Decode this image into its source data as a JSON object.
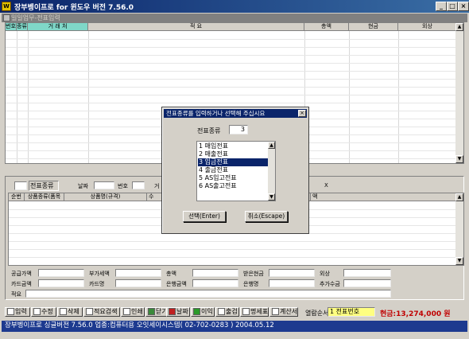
{
  "window": {
    "icon_text": "W",
    "title": "장부벵이프로 for 윈도우 버전 7.56.0",
    "minimize": "_",
    "maximize": "□",
    "close": "×"
  },
  "mdi": {
    "title": "일일업무-전표입력"
  },
  "grid1": {
    "columns": [
      "번호",
      "종류",
      "거 래 처",
      "적 요",
      "총액",
      "현금",
      "외상"
    ]
  },
  "form2": {
    "slip_type_label": "전표종류",
    "date_label": "날짜",
    "number_label": "번호",
    "partner_label": "거",
    "trailing_mark": "X",
    "columns": [
      "순번",
      "상품종류(품목",
      "상품명(규격)",
      "수",
      "액"
    ]
  },
  "summary": {
    "supply_amount": "공급가액",
    "vat": "부가세액",
    "total": "총액",
    "cash_received": "받은현금",
    "credit": "외상",
    "card_amount": "카드금액",
    "card_name": "카드명",
    "bank_amount": "은행금액",
    "bank_name": "은행명",
    "additional": "추가수금",
    "memo": "적요"
  },
  "toolbar": {
    "input": "입력",
    "edit": "수정",
    "delete": "삭제",
    "memo_search": "적요검색",
    "print": "인쇄",
    "close": "닫기",
    "date": "날짜",
    "margin": "이익",
    "ship": "출검",
    "statement": "명세표",
    "invoice": "계산서",
    "view_order_label": "열람순서",
    "view_order_value": "1 전표번호",
    "cash_text": "현금:13,274,000 원"
  },
  "status": {
    "text": "장부벵이프로 싱글버전 7.56.0    업종:컴퓨터용    오잇세이시스템( 02-702-0283 )    2004.05.12"
  },
  "dialog": {
    "title": "전표종류를 입력하거나 선택해 주십시요",
    "close": "×",
    "field_label": "전표종류",
    "field_value": "3",
    "items": [
      "1  매입전표",
      "2  매출전표",
      "3  입금전표",
      "4  출금전표",
      "5  AS입고전표",
      "6  AS출고전표"
    ],
    "selected_index": 2,
    "ok_label": "선택(Enter)",
    "cancel_label": "취소(Escape)"
  },
  "colors": {
    "title_bar": "#0a246a",
    "header_highlight": "#7fd7c8",
    "cash_text": "#c00000",
    "status_bar": "#1d3a8f"
  }
}
